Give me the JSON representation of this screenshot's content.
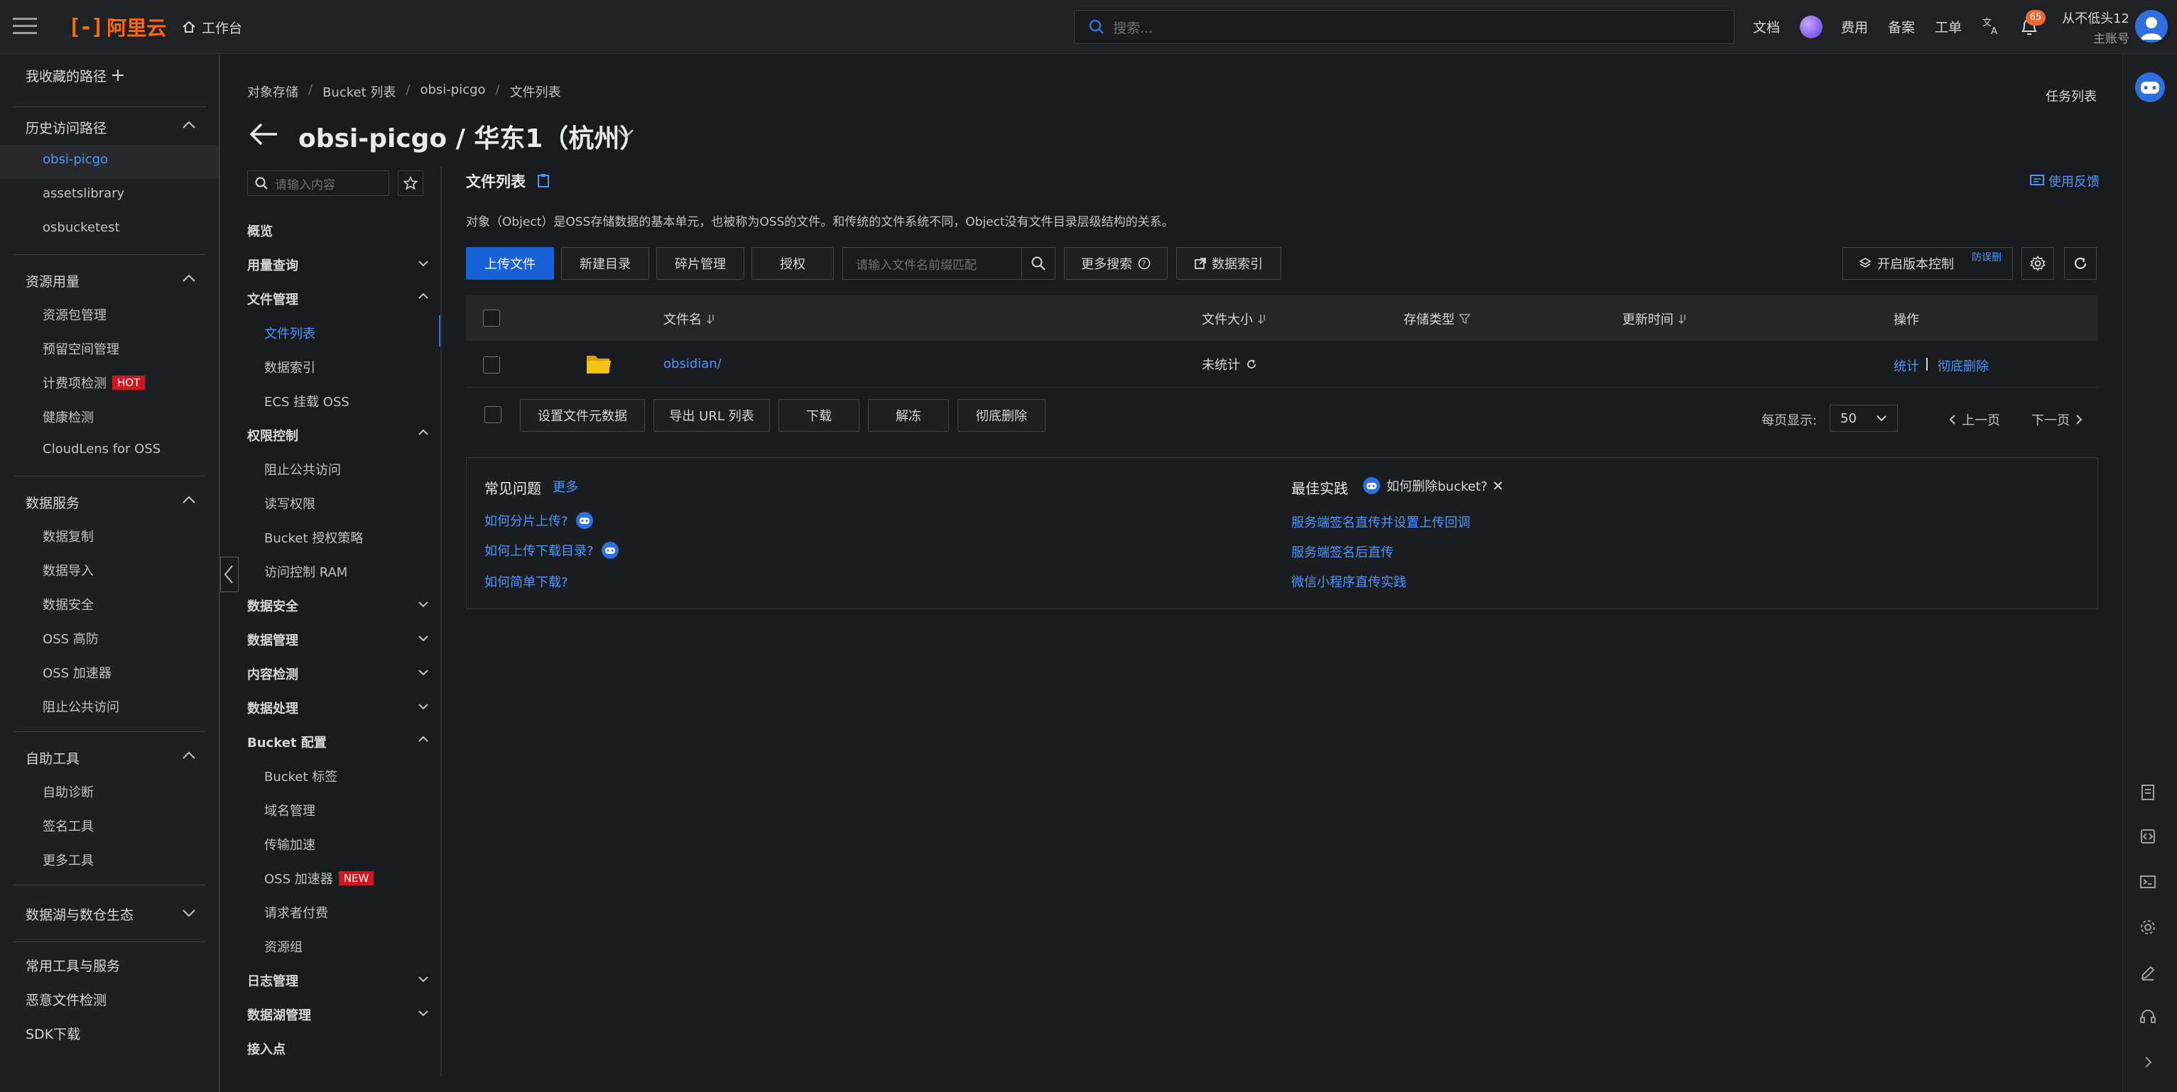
{
  "topbar": {
    "brand": "阿里云",
    "workbench": "工作台",
    "search_placeholder": "搜索...",
    "links": [
      "文档",
      "费用",
      "备案",
      "工单"
    ],
    "notification_count": "65",
    "user_name": "从不低头12",
    "user_role": "主账号"
  },
  "leftnav": {
    "favorites": "我收藏的路径",
    "history": "历史访问路径",
    "history_items": [
      "obsi-picgo",
      "assetslibrary",
      "osbucketest"
    ],
    "resource_usage": "资源用量",
    "resource_items": [
      "资源包管理",
      "预留空间管理",
      "计费项检测",
      "健康检测",
      "CloudLens for OSS"
    ],
    "hot_label": "HOT",
    "data_services": "数据服务",
    "data_items": [
      "数据复制",
      "数据导入",
      "数据安全",
      "OSS 高防",
      "OSS 加速器",
      "阻止公共访问"
    ],
    "self_tools": "自助工具",
    "tool_items": [
      "自助诊断",
      "签名工具",
      "更多工具"
    ],
    "datalake": "数据湖与数仓生态",
    "bottom_items": [
      "常用工具与服务",
      "恶意文件检测",
      "SDK下载"
    ]
  },
  "secnav": {
    "search_placeholder": "请输入内容",
    "overview": "概览",
    "usage": "用量查询",
    "file_mgmt": "文件管理",
    "file_items": [
      "文件列表",
      "数据索引",
      "ECS 挂载 OSS"
    ],
    "access": "权限控制",
    "access_items": [
      "阻止公共访问",
      "读写权限",
      "Bucket 授权策略",
      "访问控制 RAM"
    ],
    "groups": [
      "数据安全",
      "数据管理",
      "内容检测",
      "数据处理"
    ],
    "bucket_config": "Bucket 配置",
    "bucket_items": [
      "Bucket 标签",
      "域名管理",
      "传输加速",
      "OSS 加速器",
      "请求者付费",
      "资源组"
    ],
    "new_label": "NEW",
    "log_mgmt": "日志管理",
    "datalake_mgmt": "数据湖管理",
    "access_point": "接入点"
  },
  "header": {
    "breadcrumb": [
      "对象存储",
      "Bucket 列表",
      "obsi-picgo",
      "文件列表"
    ],
    "title": "obsi-picgo / 华东1（杭州）",
    "task_list": "任务列表"
  },
  "main": {
    "section_title": "文件列表",
    "feedback": "使用反馈",
    "description": "对象（Object）是OSS存储数据的基本单元，也被称为OSS的文件。和传统的文件系统不同，Object没有文件目录层级结构的关系。",
    "buttons": {
      "upload": "上传文件",
      "new_dir": "新建目录",
      "fragments": "碎片管理",
      "authorize": "授权",
      "search_placeholder": "请输入文件名前缀匹配",
      "more_search": "更多搜索",
      "data_index": "数据索引",
      "versioning": "开启版本控制",
      "versioning_tag": "防误删"
    },
    "table": {
      "headers": [
        "文件名",
        "文件大小",
        "存储类型",
        "更新时间",
        "操作"
      ],
      "rows": [
        {
          "name": "obsidian/",
          "size": "未统计",
          "actions": [
            "统计",
            "彻底删除"
          ]
        }
      ]
    },
    "batch": [
      "设置文件元数据",
      "导出 URL 列表",
      "下载",
      "解冻",
      "彻底删除"
    ],
    "pager": {
      "label": "每页显示:",
      "size": "50",
      "prev": "上一页",
      "next": "下一页"
    },
    "faq": {
      "title": "常见问题",
      "more": "更多",
      "items": [
        "如何分片上传?",
        "如何上传下载目录?",
        "如何简单下载?"
      ],
      "best_title": "最佳实践",
      "pill": "如何删除bucket?",
      "best_items": [
        "服务端签名直传并设置上传回调",
        "服务端签名后直传",
        "微信小程序直传实践"
      ]
    }
  }
}
